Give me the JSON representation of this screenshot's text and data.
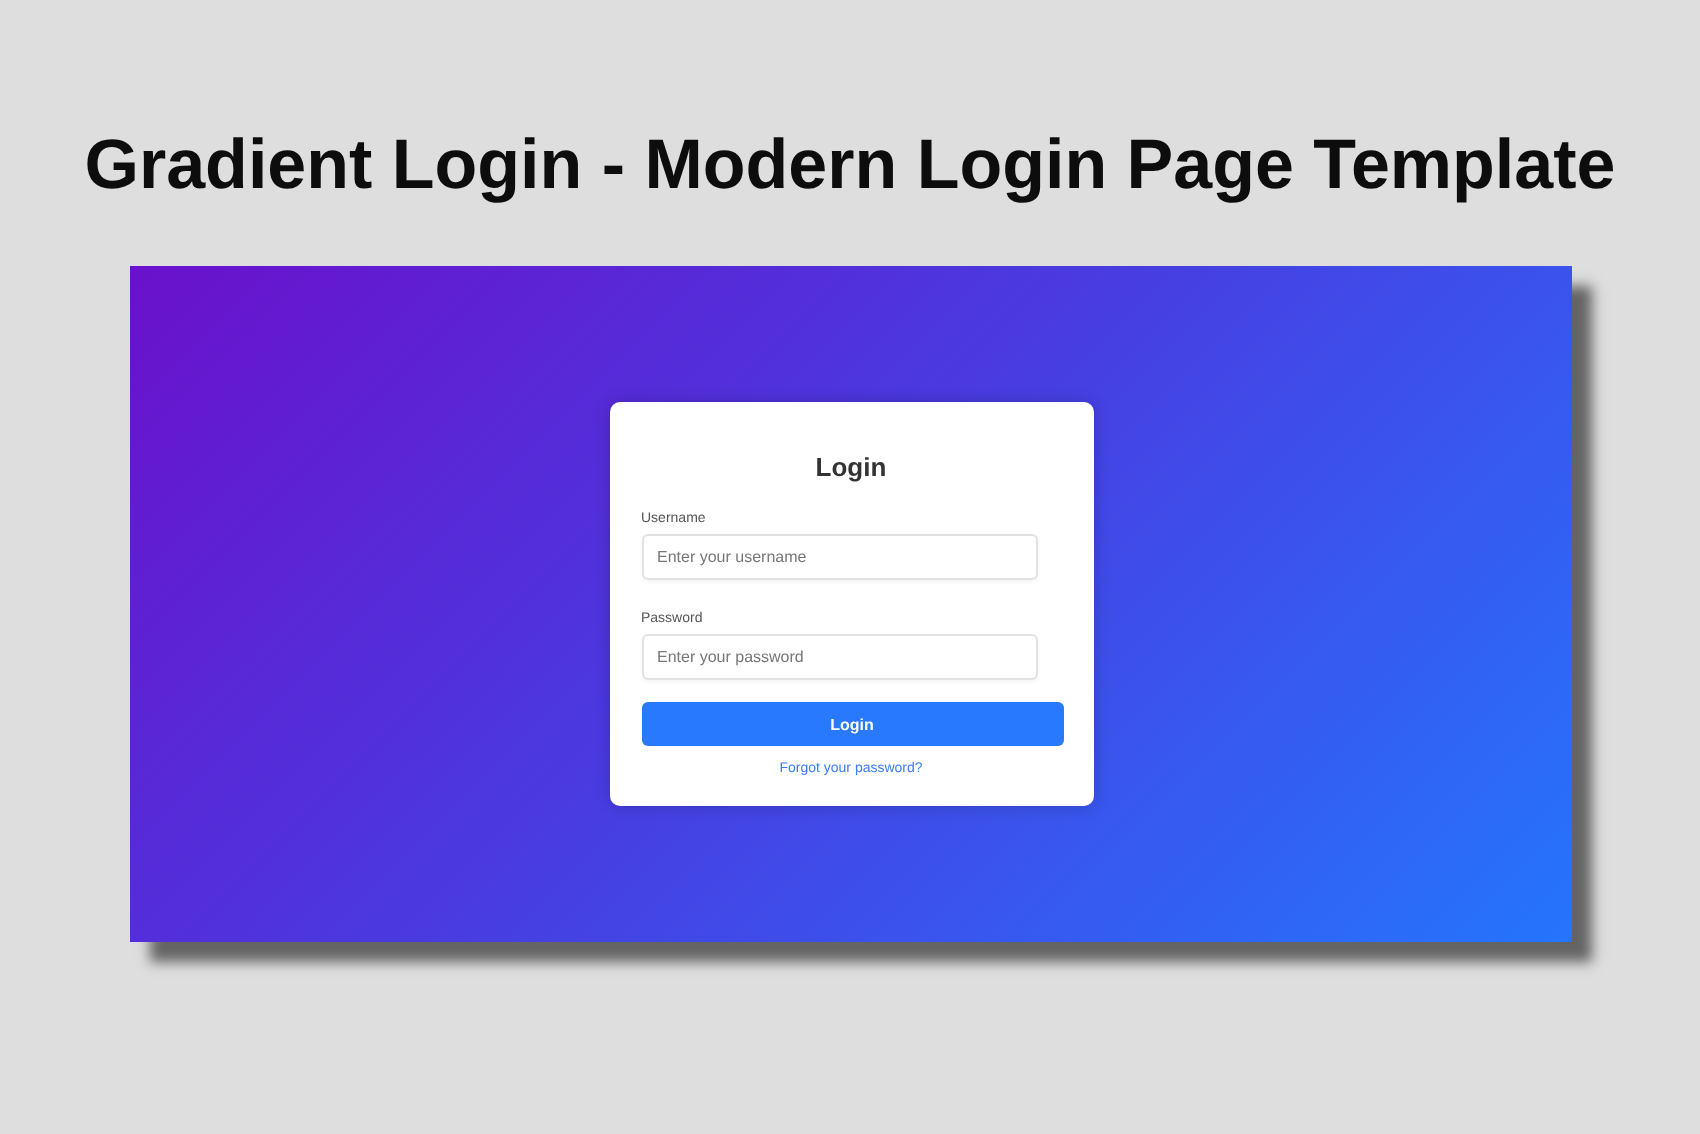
{
  "headline": "Gradient Login - Modern Login Page Template",
  "login": {
    "title": "Login",
    "fields": [
      {
        "label": "Username",
        "placeholder": "Enter your username"
      },
      {
        "label": "Password",
        "placeholder": "Enter your password"
      }
    ],
    "button": "Login",
    "link": "Forgot your password?"
  }
}
